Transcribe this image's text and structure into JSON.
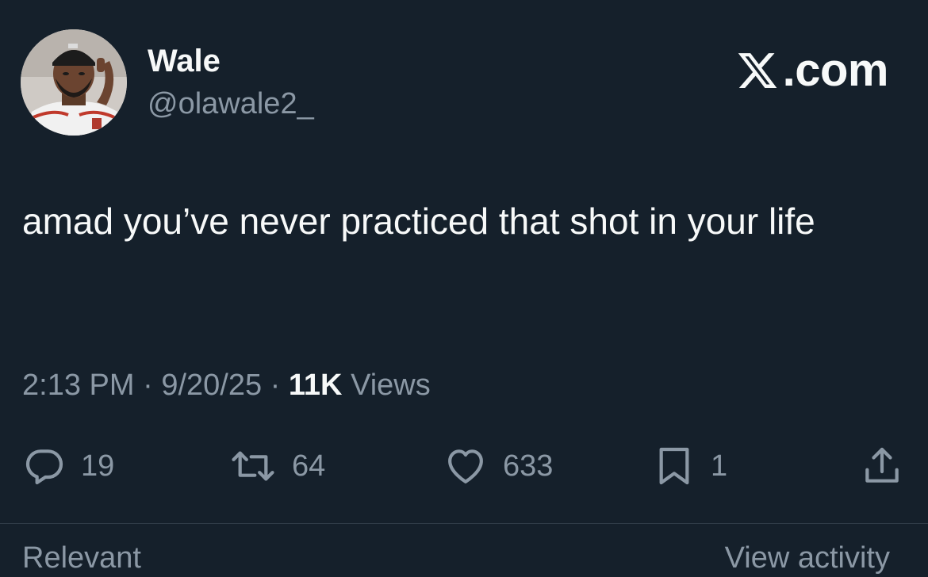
{
  "author": {
    "display_name": "Wale",
    "handle": "@olawale2_"
  },
  "brand": {
    "logo_icon": "x-logo-icon",
    "text": ".com"
  },
  "tweet": {
    "text": "amad you’ve never practiced that shot in your life"
  },
  "meta": {
    "time": "2:13 PM",
    "sep1": " · ",
    "date": "9/20/25",
    "sep2": " · ",
    "views_count": "11K",
    "views_label": " Views"
  },
  "actions": {
    "reply": {
      "icon": "reply-icon",
      "count": "19"
    },
    "retweet": {
      "icon": "retweet-icon",
      "count": "64"
    },
    "like": {
      "icon": "heart-icon",
      "count": "633"
    },
    "bookmark": {
      "icon": "bookmark-icon",
      "count": "1"
    },
    "share": {
      "icon": "share-icon"
    }
  },
  "footer": {
    "left": "Relevant",
    "right": "View activity"
  },
  "colors": {
    "background": "#15202b",
    "primary_text": "#f7f9f9",
    "secondary_text": "#8b98a5"
  }
}
